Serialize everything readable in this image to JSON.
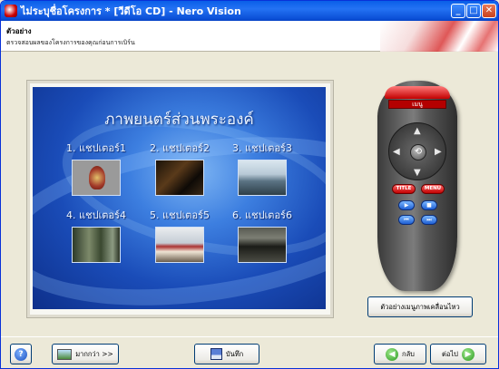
{
  "window": {
    "title": "ไม่ระบุชื่อโครงการ * [วีดีโอ CD] - Nero Vision",
    "controls": {
      "minimize": "_",
      "maximize": "□",
      "close": "✕"
    }
  },
  "header": {
    "title": "ตัวอย่าง",
    "subtitle": "ตรวจสอบผลของโครงการของคุณก่อนการเบิร์น"
  },
  "preview": {
    "movie_title": "ภาพยนตร์ส่วนพระองค์",
    "chapters": [
      {
        "label": "1. แชปเตอร์1"
      },
      {
        "label": "2. แชปเตอร์2"
      },
      {
        "label": "3. แชปเตอร์3"
      },
      {
        "label": "4. แชปเตอร์4"
      },
      {
        "label": "5. แชปเตอร์5"
      },
      {
        "label": "6. แชปเตอร์6"
      }
    ]
  },
  "remote": {
    "display": "เมนู",
    "ok_glyph": "⟲",
    "title_button": "TITLE",
    "menu_button": "MENU",
    "arrows": {
      "up": "▲",
      "down": "▼",
      "left": "◀",
      "right": "▶"
    },
    "media": {
      "play": "▶",
      "stop": "■",
      "prev": "⏮",
      "next": "⏭"
    }
  },
  "preview_motion_button": "ตัวอย่างเมนูภาพเคลื่อนไหว",
  "footer": {
    "help": "?",
    "more": "มากกว่า >>",
    "save": "บันทึก",
    "back": "กลับ",
    "next": "ต่อไป"
  },
  "colors": {
    "titlebar": "#0a5fe8",
    "accent_red": "#c20000",
    "screen_blue": "#1a4cb8",
    "button_border": "#003c74"
  }
}
